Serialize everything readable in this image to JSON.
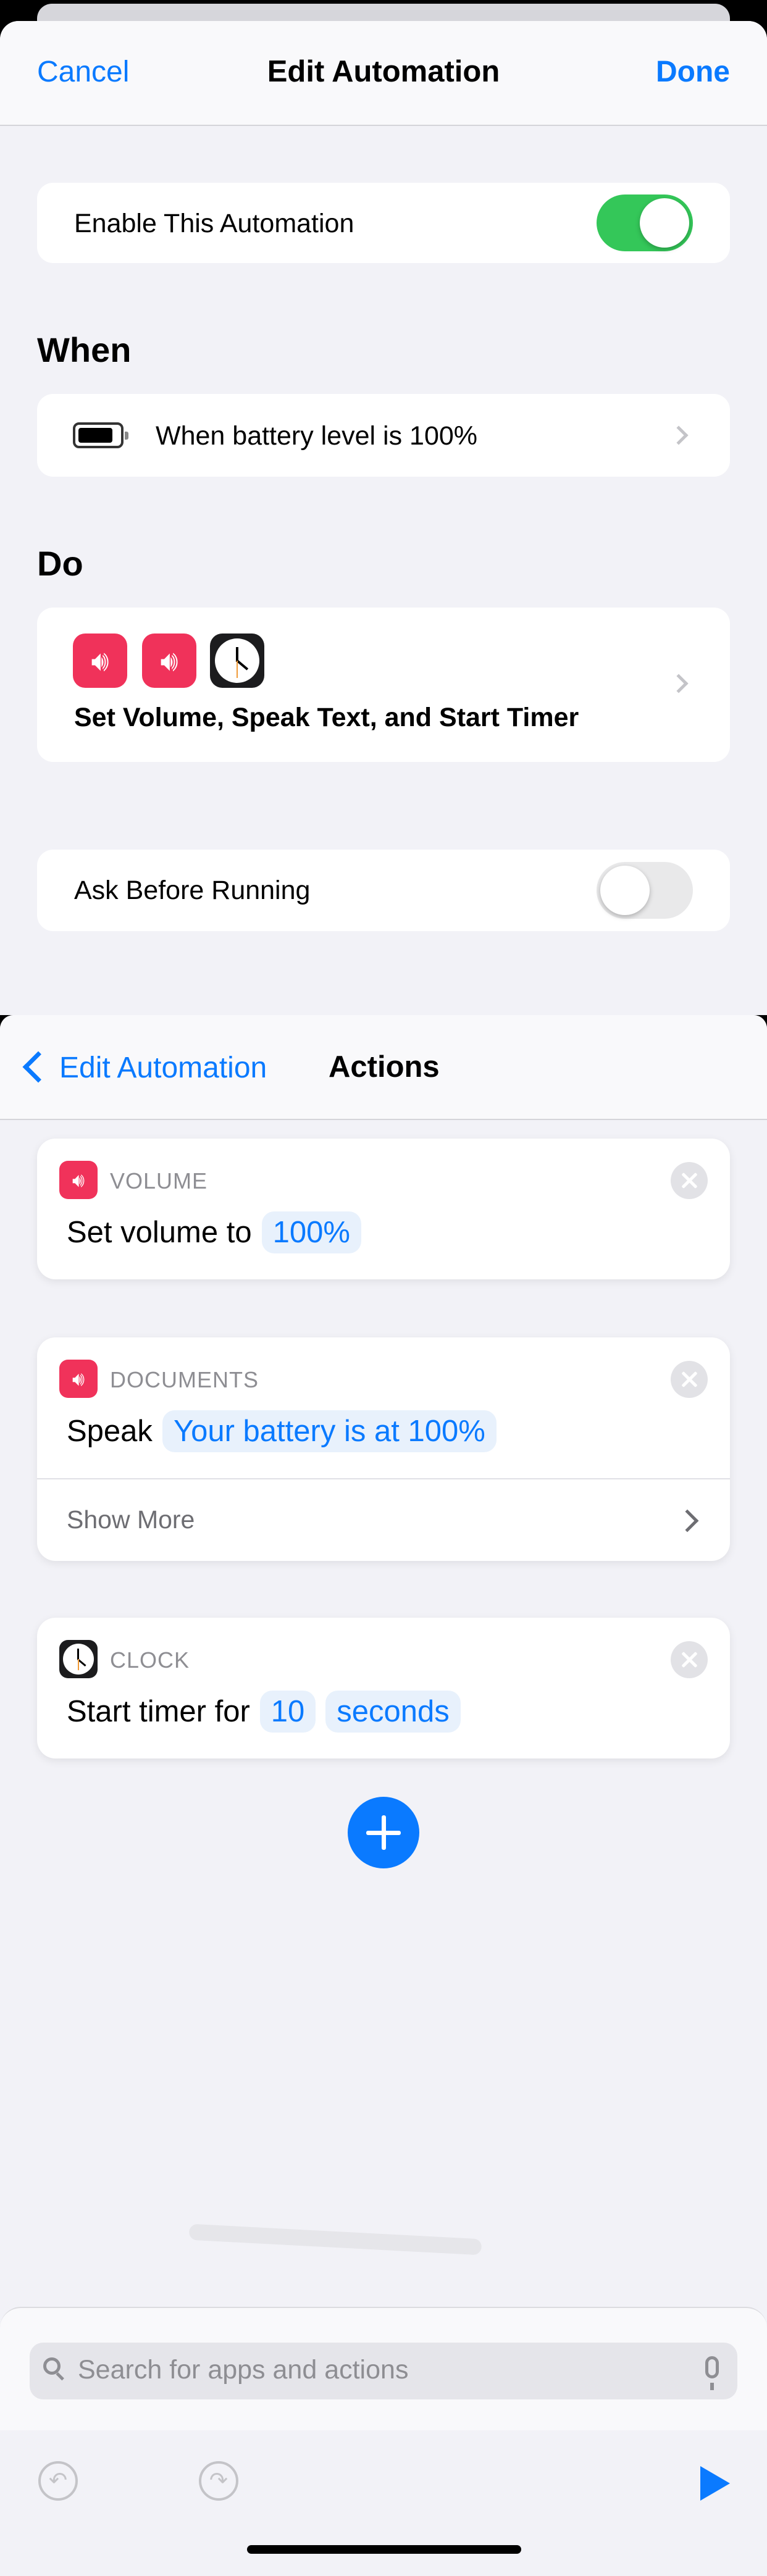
{
  "edit_automation": {
    "cancel": "Cancel",
    "title": "Edit Automation",
    "done": "Done",
    "enable_label": "Enable This Automation",
    "enable_on": true,
    "when_header": "When",
    "when_trigger": "When battery level is 100%",
    "do_header": "Do",
    "do_summary": "Set Volume, Speak Text, and Start Timer",
    "ask_label": "Ask Before Running",
    "ask_on": false
  },
  "actions_screen": {
    "back_label": "Edit Automation",
    "title": "Actions",
    "actions": [
      {
        "category": "VOLUME",
        "prefix": "Set volume to",
        "tokens": [
          "100%"
        ]
      },
      {
        "category": "DOCUMENTS",
        "prefix": "Speak",
        "tokens": [
          "Your battery is at 100%"
        ],
        "show_more": "Show More"
      },
      {
        "category": "CLOCK",
        "prefix": "Start timer for",
        "tokens": [
          "10",
          "seconds"
        ]
      }
    ],
    "search_placeholder": "Search for apps and actions"
  },
  "colors": {
    "accent": "#0a7aff",
    "toggle_on": "#34c759",
    "speaker_icon_bg": "#f0325a",
    "clock_icon_bg": "#1c1c1e"
  },
  "icons": [
    "battery-icon",
    "speaker-icon",
    "clock-icon",
    "close-icon",
    "plus-icon",
    "search-icon",
    "mic-icon",
    "undo-icon",
    "redo-icon",
    "play-icon"
  ]
}
